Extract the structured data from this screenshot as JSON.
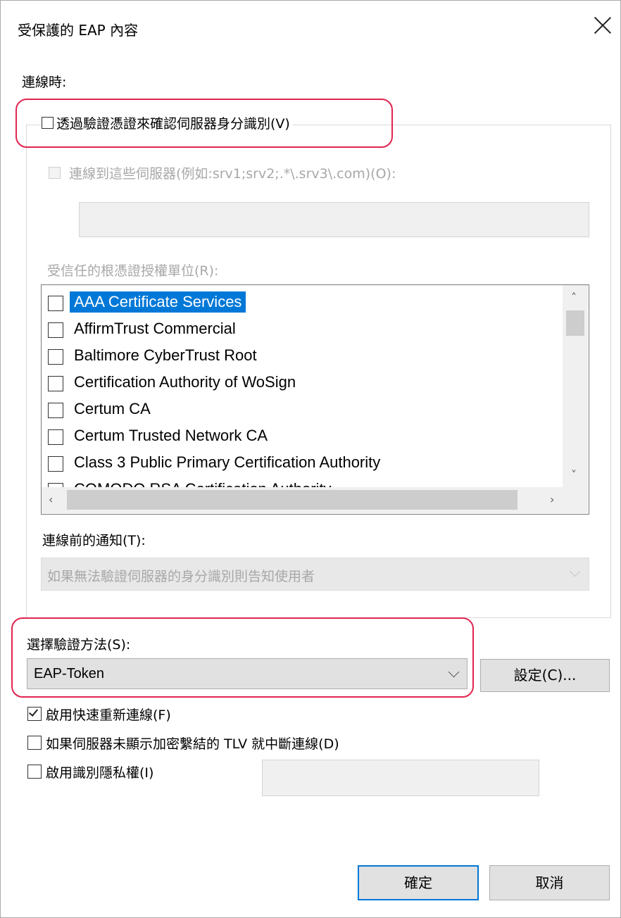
{
  "window": {
    "title": "受保護的 EAP 內容"
  },
  "connect_section": {
    "label": "連線時:"
  },
  "verify_cert": {
    "label": "透過驗證憑證來確認伺服器身分識別(V)",
    "checked": false
  },
  "connect_to_servers": {
    "label": "連線到這些伺服器(例如:srv1;srv2;.*\\.srv3\\.com)(O):",
    "value": ""
  },
  "trusted_roots": {
    "label": "受信任的根憑證授權單位(R):",
    "items": [
      {
        "name": "AAA Certificate Services",
        "checked": false,
        "selected": true
      },
      {
        "name": "AffirmTrust Commercial",
        "checked": false
      },
      {
        "name": "Baltimore CyberTrust Root",
        "checked": false
      },
      {
        "name": "Certification Authority of WoSign",
        "checked": false
      },
      {
        "name": "Certum CA",
        "checked": false
      },
      {
        "name": "Certum Trusted Network CA",
        "checked": false
      },
      {
        "name": "Class 3 Public Primary Certification Authority",
        "checked": false
      },
      {
        "name": "COMODO RSA Certification Authority",
        "checked": false
      }
    ]
  },
  "notification": {
    "label": "連線前的通知(T):",
    "value": "如果無法驗證伺服器的身分識別則告知使用者"
  },
  "auth_method": {
    "label": "選擇驗證方法(S):",
    "value": "EAP-Token",
    "configure_label": "設定(C)..."
  },
  "options": {
    "fast_reconnect": {
      "label": "啟用快速重新連線(F)",
      "checked": true
    },
    "tlv_disconnect": {
      "label": "如果伺服器未顯示加密繫結的 TLV 就中斷連線(D)",
      "checked": false
    },
    "identity_privacy": {
      "label": "啟用識別隱私權(I)",
      "checked": false,
      "value": ""
    }
  },
  "buttons": {
    "ok": "確定",
    "cancel": "取消"
  },
  "colors": {
    "accent": "#0078d7",
    "highlight_annotation": "#e02450"
  }
}
